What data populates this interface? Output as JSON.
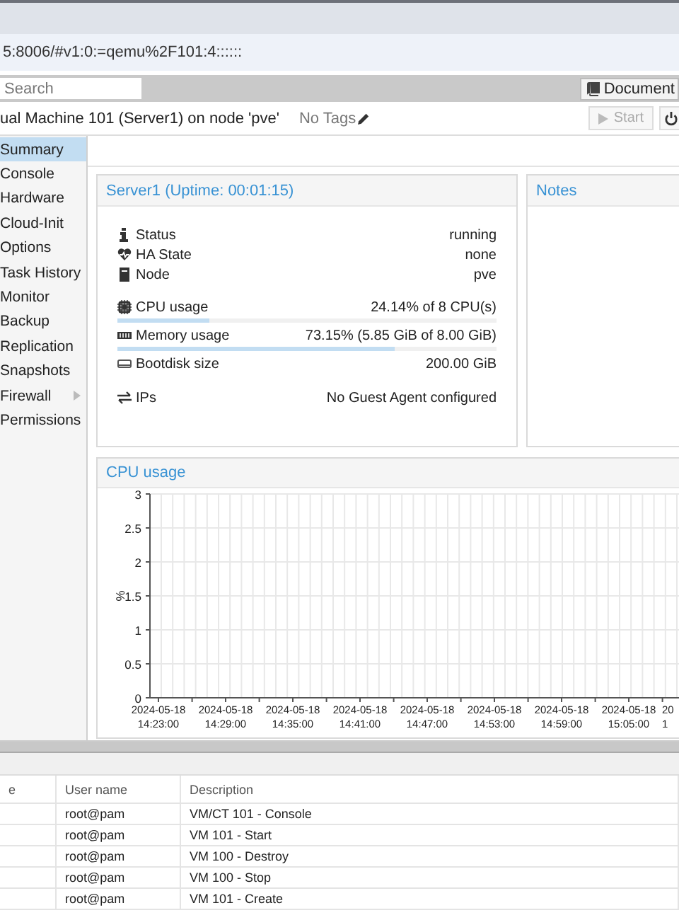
{
  "browser": {
    "address": "5:8006/#v1:0:=qemu%2F101:4::::::"
  },
  "header": {
    "search": {
      "placeholder": "Search"
    },
    "documentation_button": "Document"
  },
  "title_bar": {
    "title": "ual Machine 101 (Server1) on node 'pve'",
    "tags": "No Tags",
    "start_button": {
      "label": "Start",
      "disabled": true
    }
  },
  "sidebar": {
    "items": [
      {
        "label": "Summary",
        "selected": true
      },
      {
        "label": "Console",
        "selected": false
      },
      {
        "label": "Hardware",
        "selected": false
      },
      {
        "label": "Cloud-Init",
        "selected": false
      },
      {
        "label": "Options",
        "selected": false
      },
      {
        "label": "Task History",
        "selected": false
      },
      {
        "label": "Monitor",
        "selected": false
      },
      {
        "label": "Backup",
        "selected": false
      },
      {
        "label": "Replication",
        "selected": false
      },
      {
        "label": "Snapshots",
        "selected": false
      },
      {
        "label": "Firewall",
        "selected": false,
        "expandable": true
      },
      {
        "label": "Permissions",
        "selected": false
      }
    ]
  },
  "status_panel": {
    "title": "Server1 (Uptime: 00:01:15)",
    "rows": [
      {
        "kind": "info",
        "label": "Status",
        "value": "running"
      },
      {
        "kind": "info",
        "label": "HA State",
        "value": "none"
      },
      {
        "kind": "info",
        "label": "Node",
        "value": "pve"
      },
      {
        "kind": "meter",
        "label": "CPU usage",
        "value": "24.14% of 8 CPU(s)",
        "level": 0.2414
      },
      {
        "kind": "meter",
        "label": "Memory usage",
        "value": "73.15% (5.85 GiB of 8.00 GiB)",
        "level": 0.7315
      },
      {
        "kind": "info",
        "label": "Bootdisk size",
        "value": "200.00 GiB"
      },
      {
        "kind": "info",
        "label": "IPs",
        "value": "No Guest Agent configured"
      }
    ]
  },
  "notes_panel": {
    "title": "Notes"
  },
  "cpu_panel": {
    "title": "CPU usage",
    "chart_data": {
      "type": "line",
      "grid": true,
      "ylabel": "%",
      "ylim": [
        0,
        3
      ],
      "yticks": [
        0,
        0.5,
        1,
        1.5,
        2,
        2.5,
        3
      ],
      "categories": [
        "2024-05-18 14:23:00",
        "2024-05-18 14:29:00",
        "2024-05-18 14:35:00",
        "2024-05-18 14:41:00",
        "2024-05-18 14:47:00",
        "2024-05-18 14:53:00",
        "2024-05-18 14:59:00",
        "2024-05-18 15:05:00",
        "20 1"
      ]
    }
  },
  "tasks": {
    "columns": [
      "e",
      "User name",
      "Description"
    ],
    "rows": [
      {
        "user_name": "root@pam",
        "description": "VM/CT 101 - Console"
      },
      {
        "user_name": "root@pam",
        "description": "VM 101 - Start"
      },
      {
        "user_name": "root@pam",
        "description": "VM 100 - Destroy"
      },
      {
        "user_name": "root@pam",
        "description": "VM 100 - Stop"
      },
      {
        "user_name": "root@pam",
        "description": "VM 101 - Create"
      }
    ]
  }
}
